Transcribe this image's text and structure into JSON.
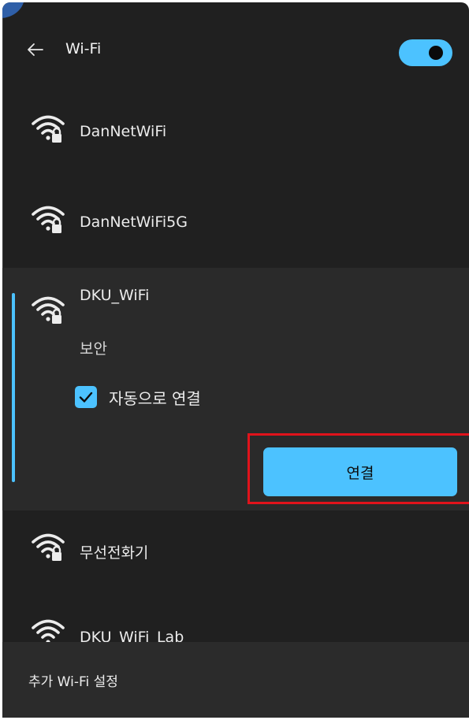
{
  "header": {
    "title": "Wi-Fi",
    "wifi_enabled": true
  },
  "networks": [
    {
      "name": "DanNetWiFi",
      "secured": true
    },
    {
      "name": "DanNetWiFi5G",
      "secured": true
    },
    {
      "name": "DKU_WiFi",
      "status": "보안",
      "secured": true,
      "auto_connect_label": "자동으로 연결",
      "auto_connect": true,
      "connect_label": "연결"
    },
    {
      "name": "무선전화기",
      "secured": true
    },
    {
      "name": "DKU_WiFi_Lab",
      "secured": true
    }
  ],
  "footer": {
    "more_settings_label": "추가 Wi-Fi 설정"
  },
  "colors": {
    "accent": "#4cc2ff",
    "background": "#202020",
    "highlight": "#e0131b"
  }
}
